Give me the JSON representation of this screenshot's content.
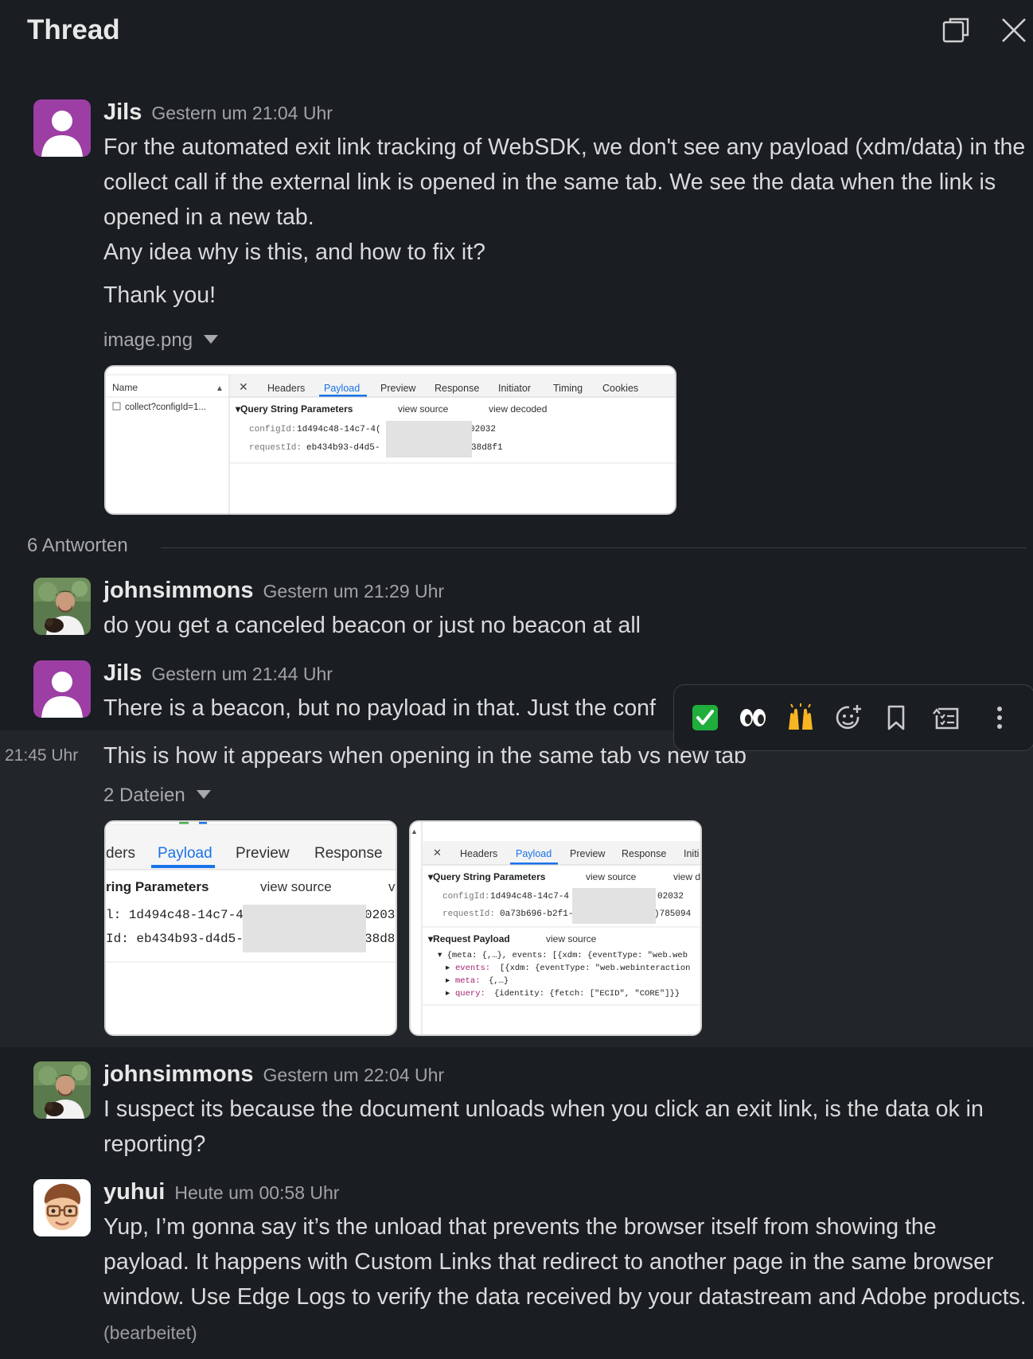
{
  "header": {
    "title": "Thread"
  },
  "parent": {
    "author": "Jils",
    "time": "Gestern um 21:04 Uhr",
    "lines": [
      "For the automated exit link tracking of WebSDK, we don't see any payload (xdm/data) in the collect call if the external link is opened in the same tab. We see the data when the link is opened in a new tab.",
      "Any idea why is this, and how to fix it?",
      "Thank you!"
    ],
    "attachment": {
      "label": "image.png",
      "network_tab": {
        "name_header": "Name",
        "request_name": "collect?configId=1...",
        "tabs": [
          "Headers",
          "Payload",
          "Preview",
          "Response",
          "Initiator",
          "Timing",
          "Cookies"
        ],
        "section": "▾Query String Parameters",
        "view_source": "view source",
        "view_decoded": "view decoded",
        "config_key": "configId:",
        "config_val_a": "1d494c48-14c7-4(",
        "config_val_b": "02032",
        "request_key": "requestId:",
        "request_val_a": "eb434b93-d4d5-",
        "request_val_b": "38d8f1"
      }
    }
  },
  "replies_divider": "6 Antworten",
  "replies": [
    {
      "author": "johnsimmons",
      "time": "Gestern um 21:29 Uhr",
      "text": "do you get a canceled beacon or just no beacon at all"
    },
    {
      "author": "Jils",
      "time": "Gestern um 21:44 Uhr",
      "text": "There is a beacon, but no payload in that. Just the conf"
    },
    {
      "side_time": "21:45 Uhr",
      "text": "This is how it appears when opening in the same tab vs new tab",
      "attachment_label": "2 Dateien",
      "shot1": {
        "tab_cut": "ders",
        "tab_payload": "Payload",
        "tab_preview": "Preview",
        "tab_response": "Response",
        "section": "ring Parameters",
        "view_source": "view source",
        "cut_v": "v",
        "row1_a": "l: 1d494c48-14c7-4(",
        "row1_b": "0203",
        "row2_a": "Id: eb434b93-d4d5-",
        "row2_b": "38d8"
      },
      "shot2": {
        "tabs": [
          "Headers",
          "Payload",
          "Preview",
          "Response",
          "Initi"
        ],
        "section": "▾Query String Parameters",
        "view_source": "view source",
        "view_cut": "view d",
        "config_key": "configId:",
        "config_val_a": "1d494c48-14c7-4",
        "config_val_b": "02032",
        "request_key": "requestId:",
        "request_val_a": "0a73b696-b2f1-",
        "request_val_b": ")785094",
        "payload_section": "▾Request Payload",
        "payload_view": "view source",
        "line1": "▾ {meta: {,…}, events: [{xdm: {eventType: \"web.web",
        "line2_key": "events:",
        "line2_val": "[{xdm: {eventType: \"web.webinteraction",
        "line3_key": "meta:",
        "line3_val": "{,…}",
        "line4_key": "query:",
        "line4_val": "{identity: {fetch: [\"ECID\", \"CORE\"]}}"
      }
    },
    {
      "author": "johnsimmons",
      "time": "Gestern um 22:04 Uhr",
      "text": "I suspect its because the document unloads when you click an exit link, is the data ok in reporting?"
    },
    {
      "author": "yuhui",
      "time": "Heute um 00:58 Uhr",
      "text": "Yup, I’m gonna say it’s the unload that prevents the browser itself from showing the payload. It happens with Custom Links that redirect to another page in the same browser window. Use Edge Logs to verify the data received by your datastream and Adobe products.",
      "edited": "(bearbeitet)"
    }
  ],
  "toolbar": {
    "reactions": [
      "✅",
      "👀",
      "🙌"
    ],
    "icons": [
      "add-reaction-icon",
      "bookmark-icon",
      "reply-list-icon",
      "more-actions-icon"
    ]
  },
  "colors": {
    "background": "#1a1d21",
    "hover": "#222529",
    "payload_tab": "#1a73e8"
  }
}
